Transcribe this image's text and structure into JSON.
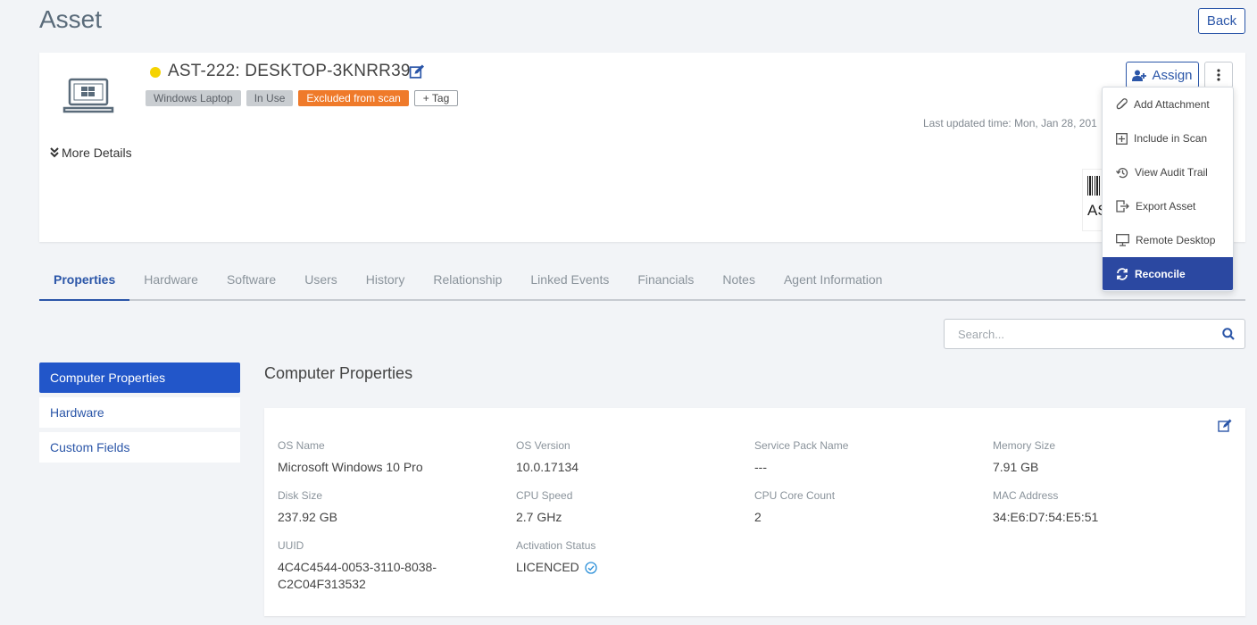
{
  "page": {
    "title": "Asset",
    "back_label": "Back"
  },
  "asset": {
    "status_color": "#f5d300",
    "name": "AST-222: DESKTOP-3KNRR39",
    "tags": [
      "Windows Laptop",
      "In Use",
      "Excluded from scan"
    ],
    "add_tag_label": "+ Tag",
    "more_details_label": "More Details",
    "last_updated": "Last updated time: Mon, Jan 28, 201",
    "barcode_text": "AS",
    "assign_label": "Assign"
  },
  "menu": {
    "items": [
      "Add Attachment",
      "Include in Scan",
      "View Audit Trail",
      "Export Asset",
      "Remote Desktop",
      "Reconcile"
    ]
  },
  "tabs": [
    "Properties",
    "Hardware",
    "Software",
    "Users",
    "History",
    "Relationship",
    "Linked Events",
    "Financials",
    "Notes",
    "Agent Information"
  ],
  "search": {
    "placeholder": "Search..."
  },
  "side_nav": [
    "Computer Properties",
    "Hardware",
    "Custom Fields"
  ],
  "section": {
    "title": "Computer Properties"
  },
  "properties": {
    "os_name": {
      "label": "OS Name",
      "value": "Microsoft Windows 10 Pro"
    },
    "os_version": {
      "label": "OS Version",
      "value": "10.0.17134"
    },
    "service_pack": {
      "label": "Service Pack Name",
      "value": "---"
    },
    "memory": {
      "label": "Memory Size",
      "value": "7.91 GB"
    },
    "disk": {
      "label": "Disk Size",
      "value": "237.92 GB"
    },
    "cpu_speed": {
      "label": "CPU Speed",
      "value": "2.7 GHz"
    },
    "cpu_cores": {
      "label": "CPU Core Count",
      "value": "2"
    },
    "mac": {
      "label": "MAC Address",
      "value": "34:E6:D7:54:E5:51"
    },
    "uuid": {
      "label": "UUID",
      "value_line1": "4C4C4544-0053-3110-8038-",
      "value_line2": "C2C04F313532"
    },
    "activation": {
      "label": "Activation Status",
      "value": "LICENCED"
    }
  }
}
